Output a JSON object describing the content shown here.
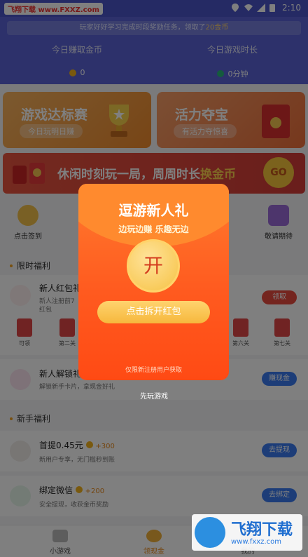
{
  "status_bar": {
    "watermark": "飞翔下载 www.FXXZ.com",
    "time": "2:10"
  },
  "header": {
    "notice_pre": "玩家好好学习完成时段奖励任务，领取了",
    "notice_amount": "20金币",
    "today_coins": {
      "label": "今日赚取金币",
      "value": "0"
    },
    "today_time": {
      "label": "今日游戏时长",
      "value": "0分钟"
    }
  },
  "banners": [
    {
      "title": "游戏达标赛",
      "pill": "今日玩明日赚"
    },
    {
      "title": "活力夺宝",
      "pill": "有活力夺惊喜"
    }
  ],
  "wide_banner": {
    "text_a": "休闲时刻玩一局，周周时长",
    "text_b": "换金币",
    "go": "GO"
  },
  "features": [
    {
      "label": "点击签到"
    },
    {
      "label": "敬请期待"
    }
  ],
  "sections": {
    "limited": "限时福利",
    "newbie": "新手福利"
  },
  "rows": {
    "redpack": {
      "title": "新人红包礼",
      "sub1": "新人注册前7",
      "sub2": "红包",
      "btn": "领取"
    },
    "unlock": {
      "title": "新人解锁礼",
      "sub": "解锁新手卡片，拿现金好礼",
      "btn": "赚现金"
    },
    "withdraw": {
      "title": "首提0.45元",
      "reward": "+300",
      "sub": "新用户专享，无门槛秒到账",
      "btn": "去提现"
    },
    "wechat": {
      "title": "绑定微信",
      "reward": "+200",
      "sub": "安全提现，收获金币奖励",
      "btn": "去绑定"
    }
  },
  "stages": [
    "可领",
    "第二关",
    "第六关",
    "第七关"
  ],
  "tabs": [
    {
      "label": "小游戏"
    },
    {
      "label": "领现金"
    },
    {
      "label": "我的"
    }
  ],
  "modal": {
    "title": "逗游新人礼",
    "subtitle": "边玩边赚 乐趣无边",
    "open": "开",
    "cta": "点击拆开红包",
    "footnote": "仅限新注册用户获取",
    "skip": "先玩游戏"
  },
  "watermark_logo": {
    "line1": "飞翔下载",
    "line2": "www.fxxz.com"
  }
}
